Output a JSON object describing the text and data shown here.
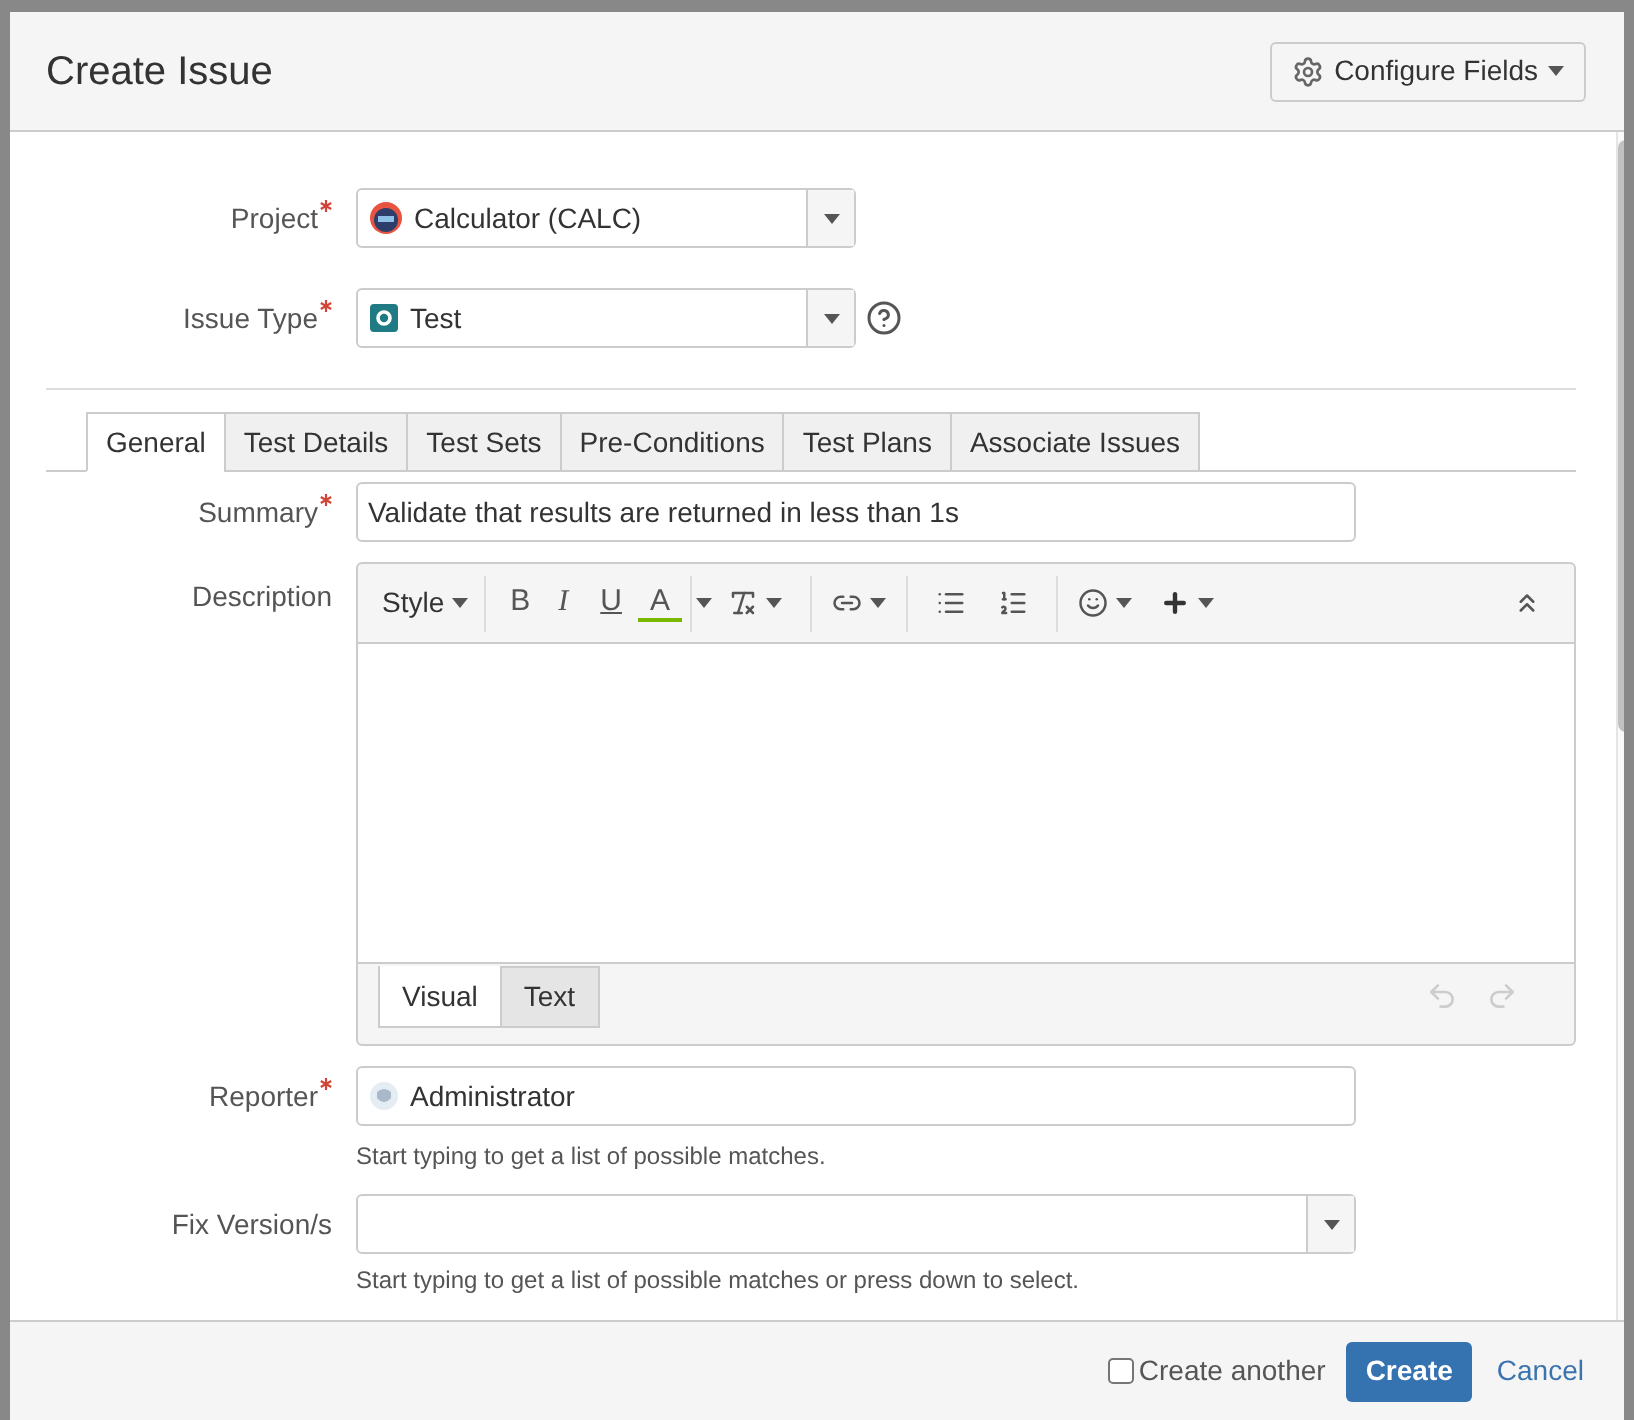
{
  "dialog": {
    "title": "Create Issue",
    "configure_button": "Configure Fields"
  },
  "project": {
    "label": "Project",
    "required": true,
    "value": "Calculator (CALC)"
  },
  "issue_type": {
    "label": "Issue Type",
    "required": true,
    "value": "Test"
  },
  "tabs": [
    {
      "label": "General",
      "selected": true
    },
    {
      "label": "Test Details",
      "selected": false
    },
    {
      "label": "Test Sets",
      "selected": false
    },
    {
      "label": "Pre-Conditions",
      "selected": false
    },
    {
      "label": "Test Plans",
      "selected": false
    },
    {
      "label": "Associate Issues",
      "selected": false
    }
  ],
  "summary": {
    "label": "Summary",
    "required": true,
    "value": "Validate that results are returned in less than 1s"
  },
  "description": {
    "label": "Description",
    "required": false,
    "toolbar": [
      {
        "kind": "style",
        "label": "Style"
      },
      {
        "kind": "bold",
        "label": "B"
      },
      {
        "kind": "italic",
        "label": "I"
      },
      {
        "kind": "underline",
        "label": "U"
      },
      {
        "kind": "color",
        "label": "A"
      }
    ],
    "editor_tabs": [
      {
        "label": "Visual",
        "selected": true
      },
      {
        "label": "Text",
        "selected": false
      }
    ]
  },
  "reporter": {
    "label": "Reporter",
    "required": true,
    "value": "Administrator",
    "hint": "Start typing to get a list of possible matches."
  },
  "fix_versions": {
    "label": "Fix Version/s",
    "required": false,
    "hint": "Start typing to get a list of possible matches or press down to select."
  },
  "footer": {
    "create_another": {
      "label": "Create another",
      "checked": false
    },
    "create_button": "Create",
    "cancel_link": "Cancel"
  }
}
